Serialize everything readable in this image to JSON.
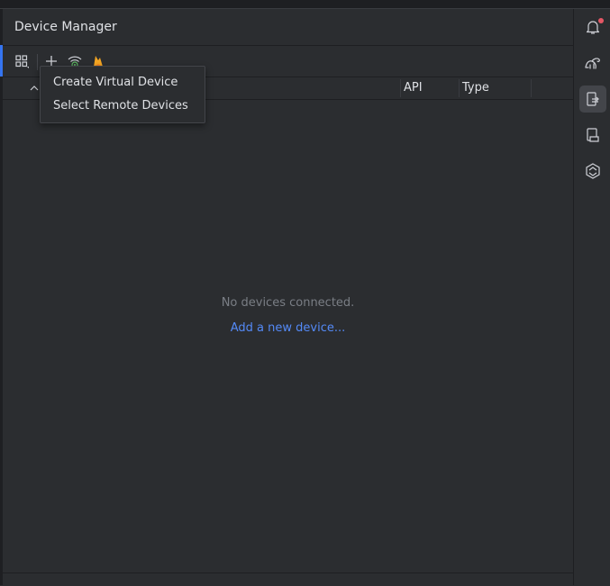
{
  "panel": {
    "title": "Device Manager"
  },
  "toolbar": {
    "buttons": [
      {
        "name": "device-grid-icon"
      },
      {
        "name": "add-device-icon"
      },
      {
        "name": "wifi-pair-icon"
      },
      {
        "name": "firebase-icon"
      }
    ]
  },
  "table": {
    "columns": [
      "API",
      "Type"
    ]
  },
  "popup": {
    "items": [
      "Create Virtual Device",
      "Select Remote Devices"
    ]
  },
  "empty_state": {
    "message": "No devices connected.",
    "link": "Add a new device..."
  },
  "right_sidebar": {
    "buttons": [
      {
        "name": "notifications-icon",
        "active": false,
        "badge": true
      },
      {
        "name": "gradle-icon",
        "active": false
      },
      {
        "name": "device-manager-icon",
        "active": true
      },
      {
        "name": "running-devices-icon",
        "active": false
      },
      {
        "name": "gemini-icon",
        "active": false
      }
    ]
  },
  "colors": {
    "background": "#2b2d30",
    "accent": "#3574f0",
    "link": "#548af7",
    "notification_badge": "#e55765"
  }
}
